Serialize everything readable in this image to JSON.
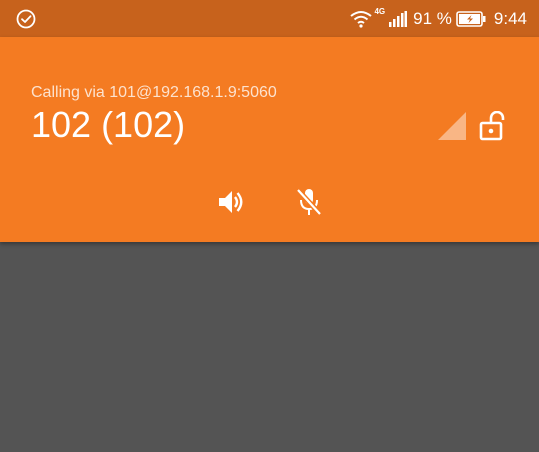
{
  "status_bar": {
    "left_icon": "check-circle-icon",
    "wifi_icon": "wifi-icon",
    "network_type": "4G",
    "signal_icon": "cell-signal-icon",
    "battery_percent": "91 %",
    "battery_icon": "battery-charging-icon",
    "time": "9:44"
  },
  "call": {
    "calling_via": "Calling via 101@192.168.1.9:5060",
    "callee": "102 (102)",
    "call_quality_icon": "signal-strength-icon",
    "security_icon": "unlocked-icon"
  },
  "controls": {
    "speaker_icon": "speaker-icon",
    "mute_icon": "microphone-muted-icon"
  },
  "colors": {
    "status_bar": "#c7621c",
    "header": "#f47b22",
    "background": "#545454",
    "text": "#ffffff"
  }
}
